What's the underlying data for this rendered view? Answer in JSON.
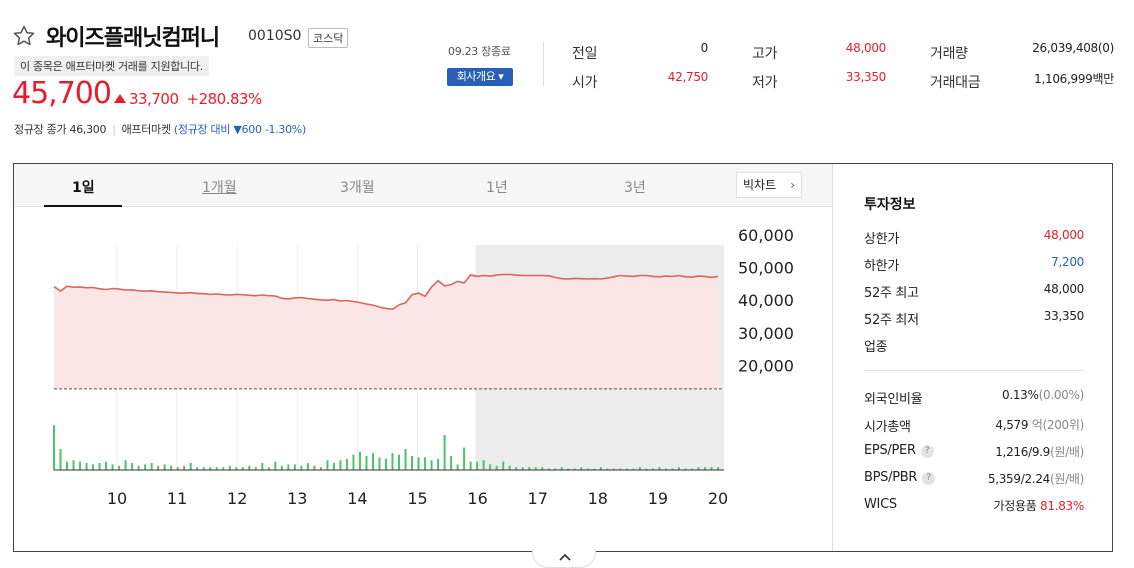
{
  "stock": {
    "name": "와이즈플래닛컴퍼니",
    "code": "0010S0",
    "market": "코스닥",
    "notice": "이 종목은 애프터마켓 거래를 지원합니다.",
    "price": "45,700",
    "change": "33,700",
    "change_pct": "+280.83%",
    "regular_close": "정규장 종가 46,300",
    "after_market": "애프터마켓",
    "after_market_detail": "(정규장 대비 ▼600 -1.30%)"
  },
  "date_info": "09.23 장종료",
  "company_button": "회사개요 ▾",
  "summary": {
    "prev_label": "전일",
    "prev": "0",
    "open_label": "시가",
    "open": "42,750",
    "high_label": "고가",
    "high": "48,000",
    "low_label": "저가",
    "low": "33,350",
    "volume_label": "거래량",
    "volume": "26,039,408(0)",
    "amount_label": "거래대금",
    "amount": "1,106,999백만"
  },
  "tabs": [
    "1일",
    "1개월",
    "3개월",
    "1년",
    "3년"
  ],
  "big_chart_button": "빅차트",
  "chart_data": {
    "type": "line",
    "x_ticks": [
      "10",
      "11",
      "12",
      "13",
      "14",
      "15",
      "16",
      "17",
      "18",
      "19",
      "20"
    ],
    "y_ticks": [
      "60,000",
      "50,000",
      "40,000",
      "30,000",
      "20,000"
    ],
    "ylim": [
      10000,
      64000
    ],
    "baseline": 12800,
    "series": [
      {
        "values": [
          44200,
          42800,
          44300,
          44000,
          44100,
          43800,
          43900,
          43500,
          43300,
          43600,
          43400,
          43100,
          43200,
          42900,
          42800,
          42900,
          42600,
          42500,
          42400,
          42200,
          42200,
          42300,
          42100,
          42000,
          41800,
          41900,
          41700,
          41600,
          41800,
          41700,
          41500,
          41400,
          41600,
          41400,
          41300,
          40600,
          40400,
          40700,
          40800,
          40500,
          40300,
          40100,
          40000,
          40200,
          39800,
          39900,
          39600,
          39300,
          38800,
          38500,
          37900,
          37500,
          37200,
          38600,
          39200,
          41700,
          42200,
          41200,
          44100,
          46000,
          44400,
          44800,
          45800,
          45300,
          47800,
          47300,
          47600,
          47400,
          47700,
          47900,
          47900,
          47700,
          47600,
          47600,
          47600,
          47600,
          47500,
          47000,
          46600,
          46500,
          46700,
          46600,
          46500,
          46600,
          46500,
          46800,
          47200,
          47600,
          47400,
          47300,
          47600,
          47600,
          47300,
          47200,
          47400,
          47300,
          47600,
          47200,
          47100,
          47400,
          47300,
          47000,
          47300
        ]
      }
    ],
    "volume": [
      0.32,
      0.15,
      0.06,
      0.07,
      0.06,
      0.05,
      0.04,
      0.05,
      0.06,
      0.04,
      0.03,
      0.07,
      0.05,
      0.03,
      0.04,
      0.05,
      0.03,
      0.04,
      0.03,
      0.02,
      0.03,
      0.05,
      0.02,
      0.02,
      0.02,
      0.02,
      0.02,
      0.03,
      0.02,
      0.02,
      0.03,
      0.02,
      0.05,
      0.02,
      0.06,
      0.03,
      0.04,
      0.04,
      0.03,
      0.05,
      0.03,
      0.02,
      0.07,
      0.05,
      0.07,
      0.08,
      0.11,
      0.13,
      0.1,
      0.12,
      0.09,
      0.08,
      0.12,
      0.11,
      0.15,
      0.1,
      0.09,
      0.09,
      0.07,
      0.08,
      0.25,
      0.1,
      0.04,
      0.16,
      0.06,
      0.06,
      0.07,
      0.04,
      0.03,
      0.06,
      0.03,
      0.02,
      0.02,
      0.02,
      0.02,
      0.02,
      0.01,
      0.01,
      0.02,
      0.01,
      0.01,
      0.02,
      0.01,
      0.01,
      0.02,
      0.01,
      0.01,
      0.01,
      0.01,
      0.01,
      0.02,
      0.01,
      0.01,
      0.02,
      0.01,
      0.01,
      0.02,
      0.01,
      0.01,
      0.02,
      0.02,
      0.02,
      0.02
    ],
    "colors": {
      "line": "#d9665e",
      "fill": "#fbe6e6",
      "volume": "#4cc26b",
      "shade": "#ececec"
    }
  },
  "invest": {
    "title": "투자정보",
    "rows": [
      {
        "label": "상한가",
        "value": "48,000"
      },
      {
        "label": "하한가",
        "value": "7,200"
      },
      {
        "label": "52주 최고",
        "value": "48,000"
      },
      {
        "label": "52주 최저",
        "value": "33,350"
      },
      {
        "label": "업종",
        "value": ""
      }
    ],
    "foreign": {
      "label": "외국인비율",
      "value": "0.13%",
      "extra": "(0.00%)"
    },
    "mktcap": {
      "label": "시가총액",
      "value": "4,579",
      "extra": "억(200위)"
    },
    "eps": {
      "label": "EPS/PER",
      "value": "1,216/9.9",
      "extra": "(원/배)"
    },
    "bps": {
      "label": "BPS/PBR",
      "value": "5,359/2.24",
      "extra": "(원/배)"
    },
    "wics": {
      "label": "WICS",
      "value": "가정용품",
      "pct": "81.83%"
    }
  }
}
